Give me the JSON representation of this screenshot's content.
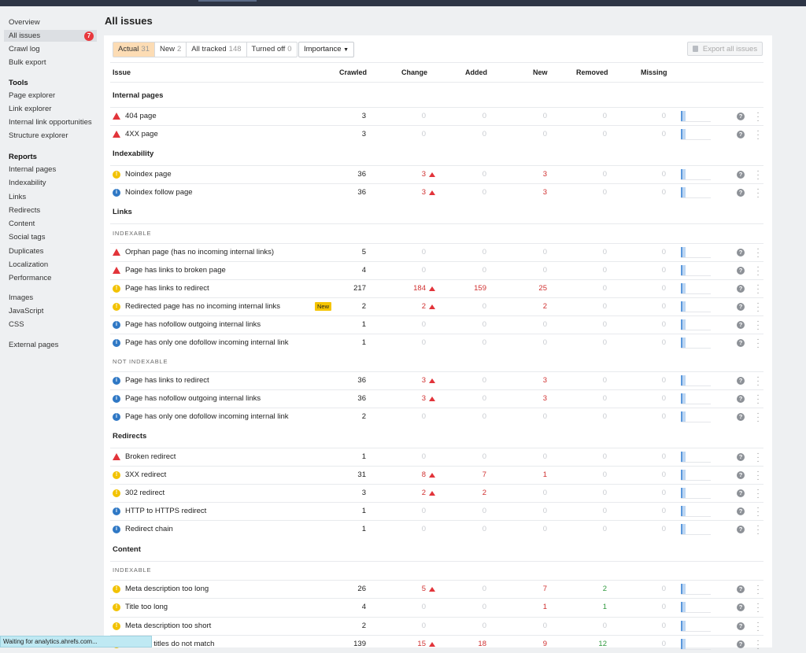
{
  "sidebar": {
    "items_top": [
      {
        "label": "Overview"
      },
      {
        "label": "All issues",
        "badge": "7",
        "active": true
      },
      {
        "label": "Crawl log"
      },
      {
        "label": "Bulk export"
      }
    ],
    "tools_heading": "Tools",
    "tools": [
      {
        "label": "Page explorer"
      },
      {
        "label": "Link explorer"
      },
      {
        "label": "Internal link opportunities"
      },
      {
        "label": "Structure explorer"
      }
    ],
    "reports_heading": "Reports",
    "reports": [
      {
        "label": "Internal pages"
      },
      {
        "label": "Indexability"
      },
      {
        "label": "Links"
      },
      {
        "label": "Redirects"
      },
      {
        "label": "Content"
      },
      {
        "label": "Social tags"
      },
      {
        "label": "Duplicates"
      },
      {
        "label": "Localization"
      },
      {
        "label": "Performance"
      }
    ],
    "resources": [
      {
        "label": "Images"
      },
      {
        "label": "JavaScript"
      },
      {
        "label": "CSS"
      }
    ],
    "external": [
      {
        "label": "External pages"
      }
    ]
  },
  "page": {
    "title": "All issues",
    "filters": [
      {
        "label": "Actual",
        "count": "31",
        "active": true
      },
      {
        "label": "New",
        "count": "2"
      },
      {
        "label": "All tracked",
        "count": "148"
      },
      {
        "label": "Turned off",
        "count": "0"
      }
    ],
    "importance_label": "Importance",
    "export_label": "Export all issues"
  },
  "table": {
    "headers": {
      "issue": "Issue",
      "crawled": "Crawled",
      "change": "Change",
      "added": "Added",
      "new": "New",
      "removed": "Removed",
      "missing": "Missing"
    },
    "sections": [
      {
        "title": "Internal pages"
      },
      {
        "title": "Indexability"
      },
      {
        "title": "Links",
        "sub1": "INDEXABLE",
        "sub2": "NOT INDEXABLE"
      },
      {
        "title": "Redirects"
      },
      {
        "title": "Content",
        "sub1": "INDEXABLE"
      }
    ],
    "rows": [
      {
        "type": "error",
        "name": "404 page",
        "crawled": "3",
        "change": "0",
        "added": "0",
        "new": "0",
        "removed": "0",
        "missing": "0"
      },
      {
        "type": "error",
        "name": "4XX page",
        "crawled": "3",
        "change": "0",
        "added": "0",
        "new": "0",
        "removed": "0",
        "missing": "0"
      },
      {
        "type": "warning",
        "name": "Noindex page",
        "crawled": "36",
        "change": "3",
        "added": "0",
        "new": "3",
        "removed": "0",
        "missing": "0",
        "up": true
      },
      {
        "type": "notice",
        "name": "Noindex follow page",
        "crawled": "36",
        "change": "3",
        "added": "0",
        "new": "3",
        "removed": "0",
        "missing": "0",
        "up": true
      },
      {
        "type": "error",
        "name": "Orphan page (has no incoming internal links)",
        "crawled": "5",
        "change": "0",
        "added": "0",
        "new": "0",
        "removed": "0",
        "missing": "0"
      },
      {
        "type": "error",
        "name": "Page has links to broken page",
        "crawled": "4",
        "change": "0",
        "added": "0",
        "new": "0",
        "removed": "0",
        "missing": "0"
      },
      {
        "type": "warning",
        "name": "Page has links to redirect",
        "crawled": "217",
        "change": "184",
        "added": "159",
        "new": "25",
        "removed": "0",
        "missing": "0",
        "up": true
      },
      {
        "type": "warning",
        "name": "Redirected page has no incoming internal links",
        "badge": "New",
        "crawled": "2",
        "change": "2",
        "added": "0",
        "new": "2",
        "removed": "0",
        "missing": "0",
        "up": true
      },
      {
        "type": "notice",
        "name": "Page has nofollow outgoing internal links",
        "crawled": "1",
        "change": "0",
        "added": "0",
        "new": "0",
        "removed": "0",
        "missing": "0"
      },
      {
        "type": "notice",
        "name": "Page has only one dofollow incoming internal link",
        "crawled": "1",
        "change": "0",
        "added": "0",
        "new": "0",
        "removed": "0",
        "missing": "0"
      },
      {
        "type": "notice",
        "name": "Page has links to redirect",
        "crawled": "36",
        "change": "3",
        "added": "0",
        "new": "3",
        "removed": "0",
        "missing": "0",
        "up": true
      },
      {
        "type": "notice",
        "name": "Page has nofollow outgoing internal links",
        "crawled": "36",
        "change": "3",
        "added": "0",
        "new": "3",
        "removed": "0",
        "missing": "0",
        "up": true
      },
      {
        "type": "notice",
        "name": "Page has only one dofollow incoming internal link",
        "crawled": "2",
        "change": "0",
        "added": "0",
        "new": "0",
        "removed": "0",
        "missing": "0"
      },
      {
        "type": "error",
        "name": "Broken redirect",
        "crawled": "1",
        "change": "0",
        "added": "0",
        "new": "0",
        "removed": "0",
        "missing": "0"
      },
      {
        "type": "warning",
        "name": "3XX redirect",
        "crawled": "31",
        "change": "8",
        "added": "7",
        "new": "1",
        "removed": "0",
        "missing": "0",
        "up": true
      },
      {
        "type": "warning",
        "name": "302 redirect",
        "crawled": "3",
        "change": "2",
        "added": "2",
        "new": "0",
        "removed": "0",
        "missing": "0",
        "up": true
      },
      {
        "type": "notice",
        "name": "HTTP to HTTPS redirect",
        "crawled": "1",
        "change": "0",
        "added": "0",
        "new": "0",
        "removed": "0",
        "missing": "0"
      },
      {
        "type": "notice",
        "name": "Redirect chain",
        "crawled": "1",
        "change": "0",
        "added": "0",
        "new": "0",
        "removed": "0",
        "missing": "0"
      },
      {
        "type": "warning",
        "name": "Meta description too long",
        "crawled": "26",
        "change": "5",
        "added": "0",
        "new": "7",
        "removed": "2",
        "missing": "0",
        "up": true
      },
      {
        "type": "warning",
        "name": "Title too long",
        "crawled": "4",
        "change": "0",
        "added": "0",
        "new": "1",
        "removed": "1",
        "missing": "0"
      },
      {
        "type": "warning",
        "name": "Meta description too short",
        "crawled": "2",
        "change": "0",
        "added": "0",
        "new": "0",
        "removed": "0",
        "missing": "0"
      },
      {
        "type": "warning",
        "name": "d SERP titles do not match",
        "crawled": "139",
        "change": "15",
        "added": "18",
        "new": "9",
        "removed": "12",
        "missing": "0",
        "up": true
      }
    ]
  },
  "status_bar": "Waiting for analytics.ahrefs.com..."
}
